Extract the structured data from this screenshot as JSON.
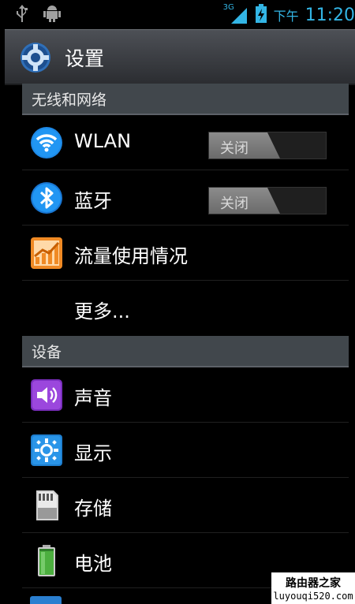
{
  "status_bar": {
    "left_icons": [
      "usb-icon",
      "android-debug-icon"
    ],
    "network_type": "3G",
    "ampm": "下午",
    "time": "11:20"
  },
  "action_bar": {
    "icon": "settings-gear-icon",
    "title": "设置"
  },
  "sections": [
    {
      "header": "无线和网络",
      "items": [
        {
          "label": "WLAN",
          "icon": "wifi-icon",
          "toggle": "关闭"
        },
        {
          "label": "蓝牙",
          "icon": "bluetooth-icon",
          "toggle": "关闭"
        },
        {
          "label": "流量使用情况",
          "icon": "data-usage-icon"
        },
        {
          "label": "更多..."
        }
      ]
    },
    {
      "header": "设备",
      "items": [
        {
          "label": "声音",
          "icon": "sound-icon"
        },
        {
          "label": "显示",
          "icon": "display-icon"
        },
        {
          "label": "存储",
          "icon": "storage-icon"
        },
        {
          "label": "电池",
          "icon": "battery-icon"
        }
      ]
    }
  ],
  "watermark": {
    "line1": "路由器之家",
    "line2": "luyouqi520.com"
  },
  "colors": {
    "accent": "#33b5e5",
    "header_bg": "#41474c",
    "background": "#000000"
  }
}
